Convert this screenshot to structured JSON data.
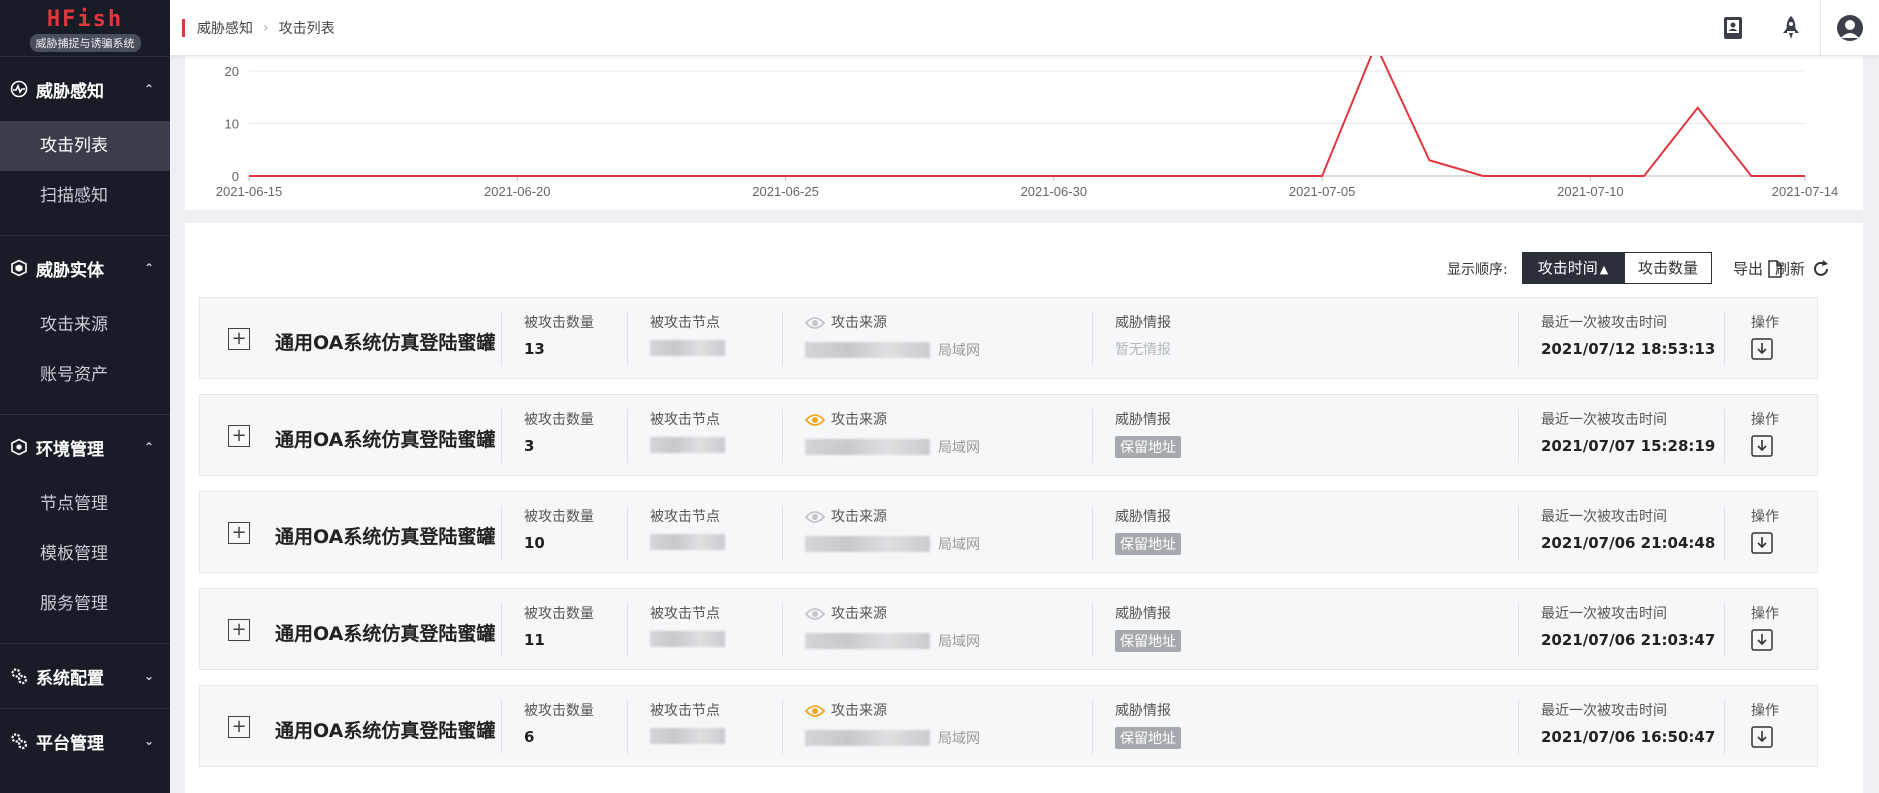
{
  "app": {
    "logo_title": "HFish",
    "logo_subtitle": "威胁捕捉与诱骗系统"
  },
  "sidebar": {
    "groups": [
      {
        "label": "威胁感知",
        "icon": "radar-icon",
        "expanded": true,
        "items": [
          {
            "label": "攻击列表",
            "active": true
          },
          {
            "label": "扫描感知",
            "active": false
          }
        ]
      },
      {
        "label": "威胁实体",
        "icon": "cube-icon",
        "expanded": true,
        "items": [
          {
            "label": "攻击来源",
            "active": false
          },
          {
            "label": "账号资产",
            "active": false
          }
        ]
      },
      {
        "label": "环境管理",
        "icon": "hexagon-icon",
        "expanded": true,
        "items": [
          {
            "label": "节点管理",
            "active": false
          },
          {
            "label": "模板管理",
            "active": false
          },
          {
            "label": "服务管理",
            "active": false
          }
        ]
      },
      {
        "label": "系统配置",
        "icon": "gears-icon",
        "expanded": false,
        "items": []
      },
      {
        "label": "平台管理",
        "icon": "gears-icon",
        "expanded": false,
        "items": []
      }
    ]
  },
  "header": {
    "breadcrumb": [
      "威胁感知",
      "攻击列表"
    ],
    "icons": [
      "manual-icon",
      "rocket-icon",
      "user-avatar-icon"
    ]
  },
  "chart_data": {
    "type": "line",
    "x": [
      "2021-06-15",
      "2021-06-16",
      "2021-06-17",
      "2021-06-18",
      "2021-06-19",
      "2021-06-20",
      "2021-06-21",
      "2021-06-22",
      "2021-06-23",
      "2021-06-24",
      "2021-06-25",
      "2021-06-26",
      "2021-06-27",
      "2021-06-28",
      "2021-06-29",
      "2021-06-30",
      "2021-07-01",
      "2021-07-02",
      "2021-07-03",
      "2021-07-04",
      "2021-07-05",
      "2021-07-06",
      "2021-07-07",
      "2021-07-08",
      "2021-07-09",
      "2021-07-10",
      "2021-07-11",
      "2021-07-12",
      "2021-07-13",
      "2021-07-14"
    ],
    "values": [
      0,
      0,
      0,
      0,
      0,
      0,
      0,
      0,
      0,
      0,
      0,
      0,
      0,
      0,
      0,
      0,
      0,
      0,
      0,
      0,
      0,
      25,
      3,
      0,
      0,
      0,
      0,
      13,
      0,
      0
    ],
    "xticks": [
      "2021-06-15",
      "2021-06-20",
      "2021-06-25",
      "2021-06-30",
      "2021-07-05",
      "2021-07-10",
      "2021-07-14"
    ],
    "yticks": [
      0,
      10,
      20
    ],
    "ylim": [
      0,
      20
    ],
    "color": "#e0373f",
    "grid": true
  },
  "list": {
    "sort_label": "显示顺序:",
    "sort_options": [
      "攻击时间",
      "攻击数量"
    ],
    "sort_active": "攻击时间",
    "export_label": "导出",
    "refresh_label": "刷新",
    "labels": {
      "count": "被攻击数量",
      "node": "被攻击节点",
      "source": "攻击来源",
      "intel": "威胁情报",
      "last_time": "最近一次被攻击时间",
      "action": "操作"
    },
    "rows": [
      {
        "title": "通用OA系统仿真登陆蜜罐",
        "count": "13",
        "source_suffix": "局域网",
        "intel": "暂无情报",
        "intel_is_tag": false,
        "source_eye_active": false,
        "last_time": "2021/07/12 18:53:13"
      },
      {
        "title": "通用OA系统仿真登陆蜜罐",
        "count": "3",
        "source_suffix": "局域网",
        "intel": "保留地址",
        "intel_is_tag": true,
        "source_eye_active": true,
        "last_time": "2021/07/07 15:28:19"
      },
      {
        "title": "通用OA系统仿真登陆蜜罐",
        "count": "10",
        "source_suffix": "局域网",
        "intel": "保留地址",
        "intel_is_tag": true,
        "source_eye_active": false,
        "last_time": "2021/07/06 21:04:48"
      },
      {
        "title": "通用OA系统仿真登陆蜜罐",
        "count": "11",
        "source_suffix": "局域网",
        "intel": "保留地址",
        "intel_is_tag": true,
        "source_eye_active": false,
        "last_time": "2021/07/06 21:03:47"
      },
      {
        "title": "通用OA系统仿真登陆蜜罐",
        "count": "6",
        "source_suffix": "局域网",
        "intel": "保留地址",
        "intel_is_tag": true,
        "source_eye_active": true,
        "last_time": "2021/07/06 16:50:47"
      }
    ]
  },
  "colors": {
    "accent": "#e0373f",
    "sidebar_bg": "#181c27",
    "eye_active": "#f5a623",
    "eye_inactive": "#c4c6cb"
  }
}
